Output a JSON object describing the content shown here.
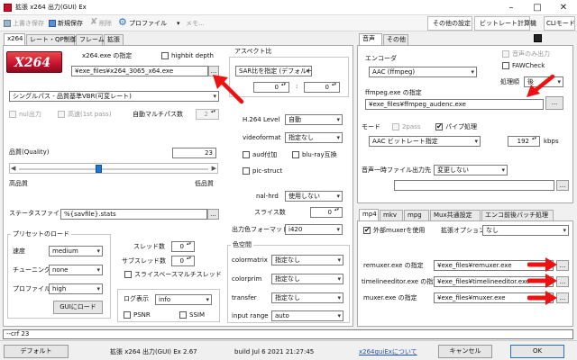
{
  "window": {
    "title": "拡張 x264 出力(GUI) Ex"
  },
  "toolbar": {
    "overwrite_save": "上書き保存",
    "new_save": "新規保存",
    "delete": "削除",
    "profile": "プロファイル",
    "profile_dropdown": "▾",
    "memo": "メモ...",
    "other_settings": "その他の設定",
    "bitrate_calc": "ビットレート計算機",
    "cli_mode": "CLIモード"
  },
  "left_tabs": [
    "x264",
    "レート・QP制御",
    "フレーム",
    "拡張"
  ],
  "x264": {
    "logo_text": "X264",
    "exe_label": "x264.exe の指定",
    "exe_path": "¥exe_files¥x264_3065_x64.exe",
    "highbit_label": "highbit depth",
    "mode_value": "シングルパス - 品質基準VBR(可変レート)",
    "nul_label": "nul出力",
    "fast1_label": "高速(1st pass)",
    "auto_multipass_label": "自動マルチパス数",
    "auto_multipass_value": "2",
    "quality_label": "品質(Quality)",
    "quality_value": "23",
    "quality_high": "高品質",
    "quality_low": "低品質",
    "quality_fraction": 0.42,
    "status_label": "ステータスファイル",
    "status_value": "%{savfile}.stats"
  },
  "preset": {
    "group_label": "プリセットのロード",
    "speed_label": "速度",
    "speed_value": "medium",
    "tune_label": "チューニング",
    "tune_value": "none",
    "profile_label": "プロファイル",
    "profile_value": "high",
    "gui_load": "GUIにロード"
  },
  "threads": {
    "threads_label": "スレッド数",
    "threads_value": "0",
    "sub_threads_label": "サブスレッド数",
    "sub_threads_value": "0",
    "slice_mt_label": "スライスベースマルチスレッド"
  },
  "log": {
    "label": "ログ表示",
    "value": "info",
    "psnr": "PSNR",
    "ssim": "SSIM"
  },
  "aspect": {
    "group_label": "アスペクト比",
    "mode_value": "SAR比を指定 (デフォルト)",
    "w_value": "0",
    "separator": ":",
    "h_value": "0"
  },
  "h264": {
    "level_label": "H.264 Level",
    "level_value": "自動",
    "videoformat_label": "videoformat",
    "videoformat_value": "指定なし",
    "aud_label": "aud付加",
    "bluray_label": "blu-ray互換",
    "picstruct_label": "pic-struct",
    "nalhrd_label": "nal-hrd",
    "nalhrd_value": "使用しない",
    "slices_label": "スライス数",
    "slices_value": "0",
    "output_format_label": "出力色フォーマット",
    "output_format_value": "i420"
  },
  "colorspace": {
    "group_label": "色空間",
    "colormatrix_label": "colormatrix",
    "colormatrix_value": "指定なし",
    "colorprim_label": "colorprim",
    "colorprim_value": "指定なし",
    "transfer_label": "transfer",
    "transfer_value": "指定なし",
    "input_range_label": "input range",
    "input_range_value": "auto"
  },
  "right_tabs": [
    "音声",
    "その他"
  ],
  "audio": {
    "encoder_label": "エンコーダ",
    "encoder_value": "AAC (ffmpeg)",
    "audio_only_label": "音声のみ出力",
    "faw_label": "FAWCheck",
    "order_label": "処理順",
    "order_value": "後",
    "ffmpeg_label": "ffmpeg.exe の指定",
    "ffmpeg_path": "¥exe_files¥ffmpeg_audenc.exe",
    "mode_label": "モード",
    "twopass_label": "2pass",
    "pipe_label": "パイプ処理",
    "mode_value": "AAC ビットレート指定",
    "bitrate_value": "192",
    "bitrate_unit": "kbps",
    "temp_label": "音声一時ファイル出力先",
    "temp_value": "変更しない"
  },
  "mux_tabs": [
    "mp4",
    "mkv",
    "mpg",
    "Mux共通設定",
    "エンコ前後バッチ処理"
  ],
  "mp4": {
    "external_muxer_label": "外部muxerを使用",
    "ext_option_label": "拡張オプション",
    "ext_option_value": "なし",
    "remuxer_label": "remuxer.exe の指定",
    "remuxer_path": "¥exe_files¥remuxer.exe",
    "timelineeditor_label": "timelineeditor.exe の指定",
    "timelineeditor_path": "¥exe_files¥timelineeditor.exe",
    "muxer_label": "muxer.exe の指定",
    "muxer_path": "¥exe_files¥muxer.exe"
  },
  "cmdline": {
    "value": "--crf 23"
  },
  "bottom": {
    "default": "デフォルト",
    "version": "拡張 x264 出力(GUI) Ex 2.67",
    "build": "build Jul  6 2021 21:27:45",
    "about": "x264guiExについて",
    "cancel": "キャンセル",
    "ok": "OK"
  },
  "colors": {
    "arrow_red": "#ee1111",
    "tab_active": "#ffffff",
    "logo_bg": "#c8102e"
  }
}
